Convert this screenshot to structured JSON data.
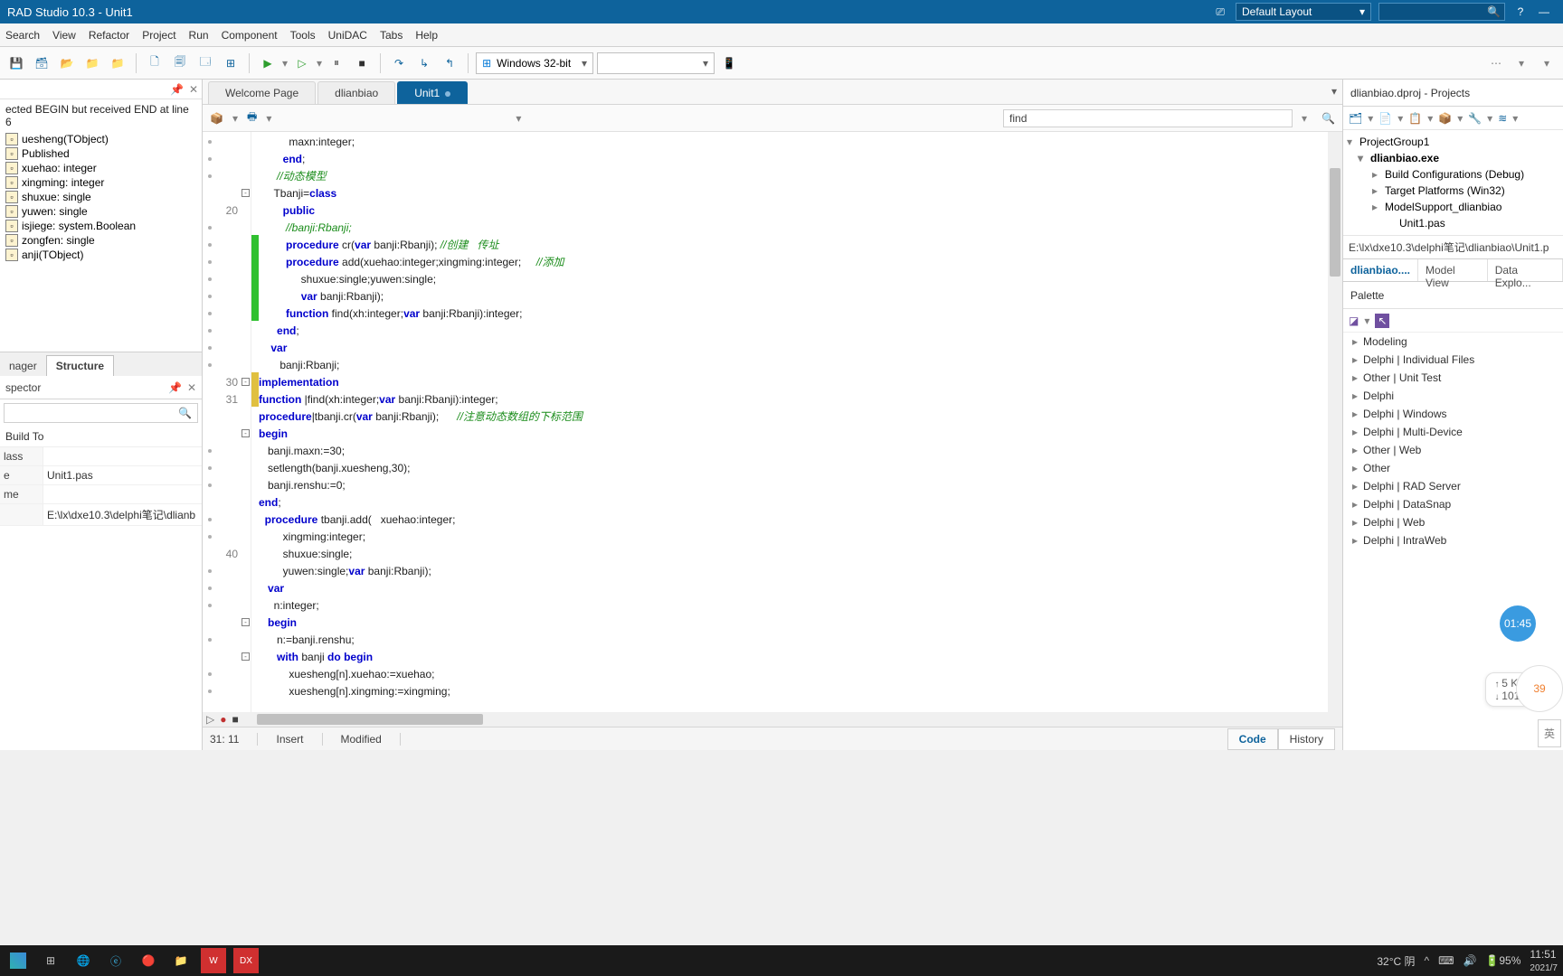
{
  "window": {
    "title": "RAD Studio 10.3 - Unit1",
    "layout": "Default Layout"
  },
  "menu": [
    "Search",
    "View",
    "Refactor",
    "Project",
    "Run",
    "Component",
    "Tools",
    "UniDAC",
    "Tabs",
    "Help"
  ],
  "toolbar": {
    "platform": "Windows 32-bit"
  },
  "doc_tabs": [
    {
      "label": "Welcome Page",
      "active": false
    },
    {
      "label": "dlianbiao",
      "active": false
    },
    {
      "label": "Unit1",
      "active": true,
      "modified": true
    }
  ],
  "find_text": "find",
  "structure": {
    "error": "ected BEGIN but received END at line 6",
    "items": [
      "uesheng(TObject)",
      "Published",
      "xuehao: integer",
      "xingming: integer",
      "shuxue: single",
      "yuwen: single",
      "isjiege: system.Boolean",
      "zongfen: single",
      "anji(TObject)"
    ]
  },
  "left_tabs": {
    "a": "nager",
    "b": "Structure"
  },
  "inspector": {
    "title": "spector",
    "build": "Build To",
    "rows": [
      {
        "k": "lass",
        "v": ""
      },
      {
        "k": "e",
        "v": "Unit1.pas"
      },
      {
        "k": "me",
        "v": ""
      },
      {
        "k": "",
        "v": "E:\\lx\\dxe10.3\\delphi笔记\\dlianb"
      }
    ]
  },
  "code": {
    "lines": [
      {
        "n": "",
        "dot": true,
        "text": "          maxn:integer;"
      },
      {
        "n": "",
        "dot": true,
        "text": "        <kw>end</kw>;"
      },
      {
        "n": "",
        "dot": true,
        "text": "      <cm>//动态模型</cm>"
      },
      {
        "n": "",
        "fold": "-",
        "text": "     Tbanji=<kw>class</kw>"
      },
      {
        "n": "20",
        "text": "        <kw>public</kw>"
      },
      {
        "n": "",
        "dot": true,
        "text": "         <cm>//banji:Rbanji;</cm>"
      },
      {
        "n": "",
        "dot": true,
        "text": "         <kw>procedure</kw> cr(<kw>var</kw> banji:Rbanji); <cm>//创建   传址</cm>"
      },
      {
        "n": "",
        "dot": true,
        "text": "         <kw>procedure</kw> add(xuehao:integer;xingming:integer;     <cm>//添加</cm>"
      },
      {
        "n": "",
        "dot": true,
        "text": "              shuxue:single;yuwen:single;"
      },
      {
        "n": "",
        "dot": true,
        "text": "              <kw>var</kw> banji:Rbanji);"
      },
      {
        "n": "",
        "dot": true,
        "text": "         <kw>function</kw> find(xh:integer;<kw>var</kw> banji:Rbanji):integer;"
      },
      {
        "n": "",
        "dot": true,
        "text": "      <kw>end</kw>;"
      },
      {
        "n": "",
        "dot": true,
        "text": "    <kw>var</kw>"
      },
      {
        "n": "",
        "dot": true,
        "text": "       banji:Rbanji;"
      },
      {
        "n": "30",
        "fold": "-",
        "text": "<kw>implementation</kw>"
      },
      {
        "n": "31",
        "hl": true,
        "text": "<kw>function</kw> |find(xh:integer;<kw>var</kw> banji:Rbanji):integer;"
      },
      {
        "n": "",
        "text": "<kw>procedure</kw>|tbanji.cr(<kw>var</kw> banji:Rbanji);      <cm>//注意动态数组的下标范围</cm>"
      },
      {
        "n": "",
        "fold": "-",
        "text": "<kw>begin</kw>"
      },
      {
        "n": "",
        "dot": true,
        "text": "   banji.maxn:=30;"
      },
      {
        "n": "",
        "dot": true,
        "text": "   setlength(banji.xuesheng,30);"
      },
      {
        "n": "",
        "dot": true,
        "text": "   banji.renshu:=0;"
      },
      {
        "n": "",
        "text": "<kw>end</kw>;"
      },
      {
        "n": "",
        "dot": true,
        "text": "  <kw>procedure</kw> tbanji.add(   xuehao:integer;"
      },
      {
        "n": "",
        "dot": true,
        "text": "        xingming:integer;"
      },
      {
        "n": "40",
        "text": "        shuxue:single;"
      },
      {
        "n": "",
        "dot": true,
        "text": "        yuwen:single;<kw>var</kw> banji:Rbanji);"
      },
      {
        "n": "",
        "dot": true,
        "text": "   <kw>var</kw>"
      },
      {
        "n": "",
        "dot": true,
        "text": "     n:integer;"
      },
      {
        "n": "",
        "fold": "-",
        "text": "   <kw>begin</kw>"
      },
      {
        "n": "",
        "dot": true,
        "text": "      n:=banji.renshu;"
      },
      {
        "n": "",
        "fold": "-",
        "text": "      <kw>with</kw> banji <kw>do</kw> <kw>begin</kw>"
      },
      {
        "n": "",
        "dot": true,
        "text": "          xuesheng[n].xuehao:=xuehao;"
      },
      {
        "n": "",
        "dot": true,
        "text": "          xuesheng[n].xingming:=xingming;"
      }
    ]
  },
  "status": {
    "pos": "31: 11",
    "mode": "Insert",
    "modified": "Modified",
    "tabs": [
      "Code",
      "History"
    ]
  },
  "projects": {
    "title": "dlianbiao.dproj - Projects",
    "tree": [
      {
        "label": "ProjectGroup1",
        "indent": 0,
        "chev": "▾"
      },
      {
        "label": "dlianbiao.exe",
        "indent": 1,
        "chev": "▾",
        "bold": true
      },
      {
        "label": "Build Configurations (Debug)",
        "indent": 2,
        "chev": "▸"
      },
      {
        "label": "Target Platforms (Win32)",
        "indent": 2,
        "chev": "▸"
      },
      {
        "label": "ModelSupport_dlianbiao",
        "indent": 2,
        "chev": "▸"
      },
      {
        "label": "Unit1.pas",
        "indent": 3
      }
    ],
    "path": "E:\\lx\\dxe10.3\\delphi笔记\\dlianbiao\\Unit1.p",
    "mid_tabs": [
      "dlianbiao....",
      "Model View",
      "Data Explo..."
    ]
  },
  "palette": {
    "title": "Palette",
    "cats": [
      "Modeling",
      "Delphi | Individual Files",
      "Other | Unit Test",
      "Delphi",
      "Delphi | Windows",
      "Delphi | Multi-Device",
      "Other | Web",
      "Other",
      "Delphi | RAD Server",
      "Delphi | DataSnap",
      "Delphi | Web",
      "Delphi | IntraWeb"
    ]
  },
  "taskbar": {
    "weather": "32°C 阴",
    "battery": "95%",
    "time": "11:51",
    "date": "2021/7"
  },
  "overlay": {
    "timer": "01:45",
    "up": "5 K/s",
    "down": "101 K/s",
    "temp": "39",
    "ime": "英"
  }
}
